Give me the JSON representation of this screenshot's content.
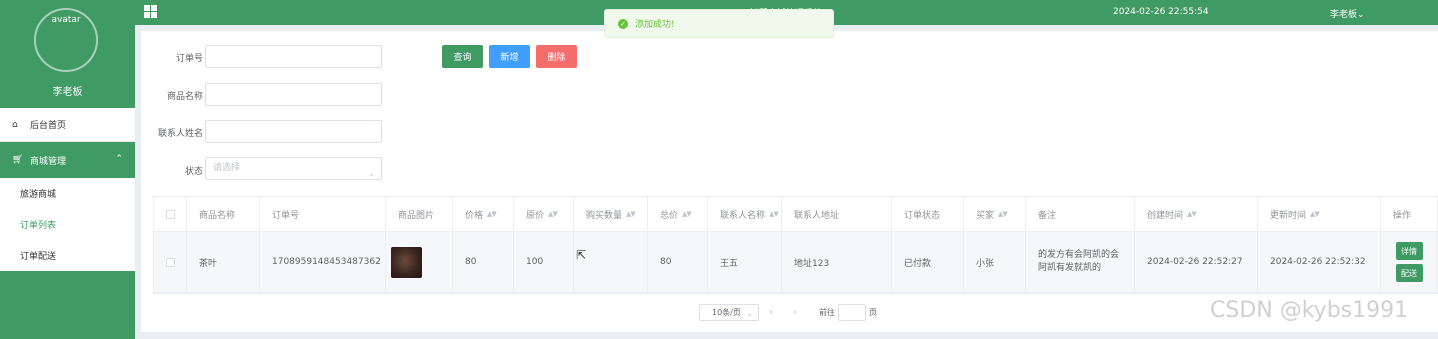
{
  "sidebar": {
    "avatar_alt": "avatar",
    "user_name": "李老板",
    "home": "后台首页",
    "group": "商城管理",
    "items": [
      "旅游商城",
      "订单列表",
      "订单配送"
    ],
    "active_item": "订单列表"
  },
  "header": {
    "system_title": "智慧商城管理系统",
    "datetime": "2024-02-26 22:55:54",
    "user": "李老板"
  },
  "toast": {
    "message": "添加成功!"
  },
  "filters": {
    "order_no_label": "订单号",
    "product_name_label": "商品名称",
    "contact_name_label": "联系人姓名",
    "status_label": "状态",
    "status_placeholder": "请选择"
  },
  "buttons": {
    "query": "查询",
    "add": "新增",
    "delete": "删除"
  },
  "table": {
    "columns": [
      "商品名称",
      "订单号",
      "商品图片",
      "价格",
      "原价",
      "购买数量",
      "总价",
      "联系人名称",
      "联系人地址",
      "订单状态",
      "买家",
      "备注",
      "创建时间",
      "更新时间",
      "操作"
    ],
    "rows": [
      {
        "product_name": "茶叶",
        "order_no": "1708959148453487362",
        "price": "80",
        "original_price": "100",
        "quantity": "",
        "total": "80",
        "contact_name": "王五",
        "contact_address": "地址123",
        "status": "已付款",
        "buyer": "小张",
        "remark": "的发方有会阿凯的会阿凯有发就凯的",
        "created_at": "2024-02-26 22:52:27",
        "updated_at": "2024-02-26 22:52:32",
        "op_detail": "详情",
        "op_ship": "配送"
      }
    ]
  },
  "pagination": {
    "page_size": "10条/页",
    "goto_label": "前往",
    "page_unit": "页"
  },
  "watermark": "CSDN @kybs1991",
  "colors": {
    "primary": "#409a64",
    "add": "#409eff",
    "danger": "#f56c6c"
  }
}
